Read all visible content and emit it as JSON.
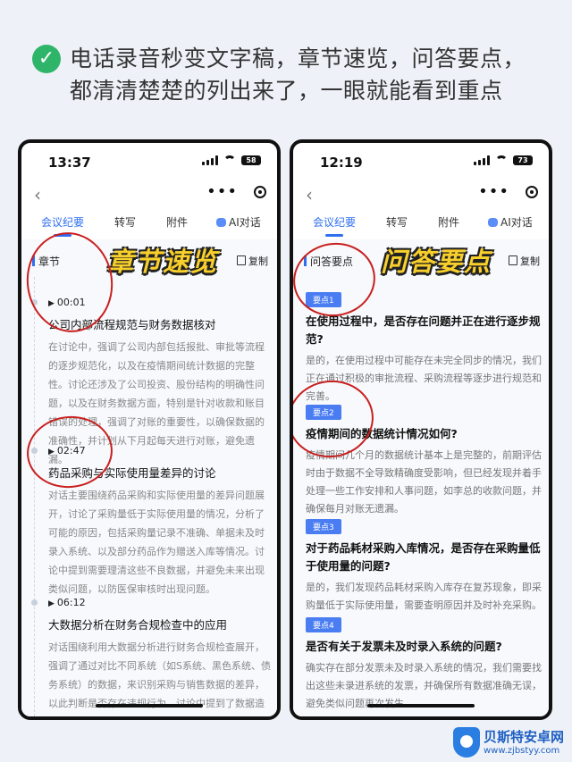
{
  "headline": {
    "line1": "电话录音秒变文字稿，章节速览，问答要点，",
    "line2": "都清清楚楚的列出来了，一眼就能看到重点"
  },
  "left_phone": {
    "time": "13:37",
    "battery": "58",
    "tabs": [
      "会议纪要",
      "转写",
      "附件",
      "AI对话"
    ],
    "section": "章节",
    "copy": "复制",
    "banner": "章节速览",
    "chapters": [
      {
        "time": "00:01",
        "title": "公司内部流程规范与财务数据核对",
        "body": "在讨论中，强调了公司内部包括报批、审批等流程的逐步规范化，以及在疫情期间统计数据的完整性。讨论还涉及了公司投资、股份结构的明确性问题，以及在财务数据方面，特别是针对收款和账目错误的处理，强调了对账的重要性，以确保数据的准确性，并计划从下月起每天进行对账，避免遗漏。"
      },
      {
        "time": "02:47",
        "title": "药品采购与实际使用量差异的讨论",
        "body": "对话主要围绕药品采购和实际使用量的差异问题展开，讨论了采购量低于实际使用量的情况，分析了可能的原因，包括采购量记录不准确、单据未及时录入系统、以及部分药品作为赠送入库等情况。讨论中提到需要理清这些不良数据，并避免未来出现类似问题，以防医保审核时出现问题。"
      },
      {
        "time": "06:12",
        "title": "大数据分析在财务合规检查中的应用",
        "body": "对话围绕利用大数据分析进行财务合规检查展开，强调了通过对比不同系统（如S系统、黑色系统、债务系统）的数据，来识别采购与销售数据的差异，以此判断是否存在违规行为。讨论中提到了数据造假的风险、医保检查的重要性以及数据准确性对于避免违法和合规风险的关键作"
      }
    ]
  },
  "right_phone": {
    "time": "12:19",
    "battery": "73",
    "tabs": [
      "会议纪要",
      "转写",
      "附件",
      "AI对话"
    ],
    "section": "问答要点",
    "copy": "复制",
    "banner": "问答要点",
    "items": [
      {
        "badge": "要点1",
        "question": "在使用过程中，是否存在问题并正在进行逐步规范?",
        "answer": "是的，在使用过程中可能存在未完全同步的情况，我们正在通过积极的审批流程、采购流程等逐步进行规范和完善。"
      },
      {
        "badge": "要点2",
        "question": "疫情期间的数据统计情况如何?",
        "answer": "疫情期间几个月的数据统计基本上是完整的，前期评估时由于数据不全导致精确度受影响，但已经发现并着手处理一些工作安排和人事问题，如李总的收款问题，并确保每月对账无遗漏。"
      },
      {
        "badge": "要点3",
        "question": "对于药品耗材采购入库情况，是否存在采购量低于使用量的问题?",
        "answer": "是的，我们发现药品耗材采购入库存在复苏现象，即采购量低于实际使用量，需要查明原因并及时补充采购。"
      },
      {
        "badge": "要点4",
        "question": "是否有关于发票未及时录入系统的问题?",
        "answer": "确实存在部分发票未及时录入系统的情况，我们需要找出这些未录进系统的发票，并确保所有数据准确无误，避免类似问题再次发生。"
      }
    ]
  },
  "watermark": {
    "name": "贝斯特安卓网",
    "url": "www.zjbstyy.com"
  },
  "colors": {
    "accent": "#2e6ff0",
    "annotation": "#c91f1f",
    "banner": "#f8cf2b",
    "check": "#2fb56a"
  }
}
